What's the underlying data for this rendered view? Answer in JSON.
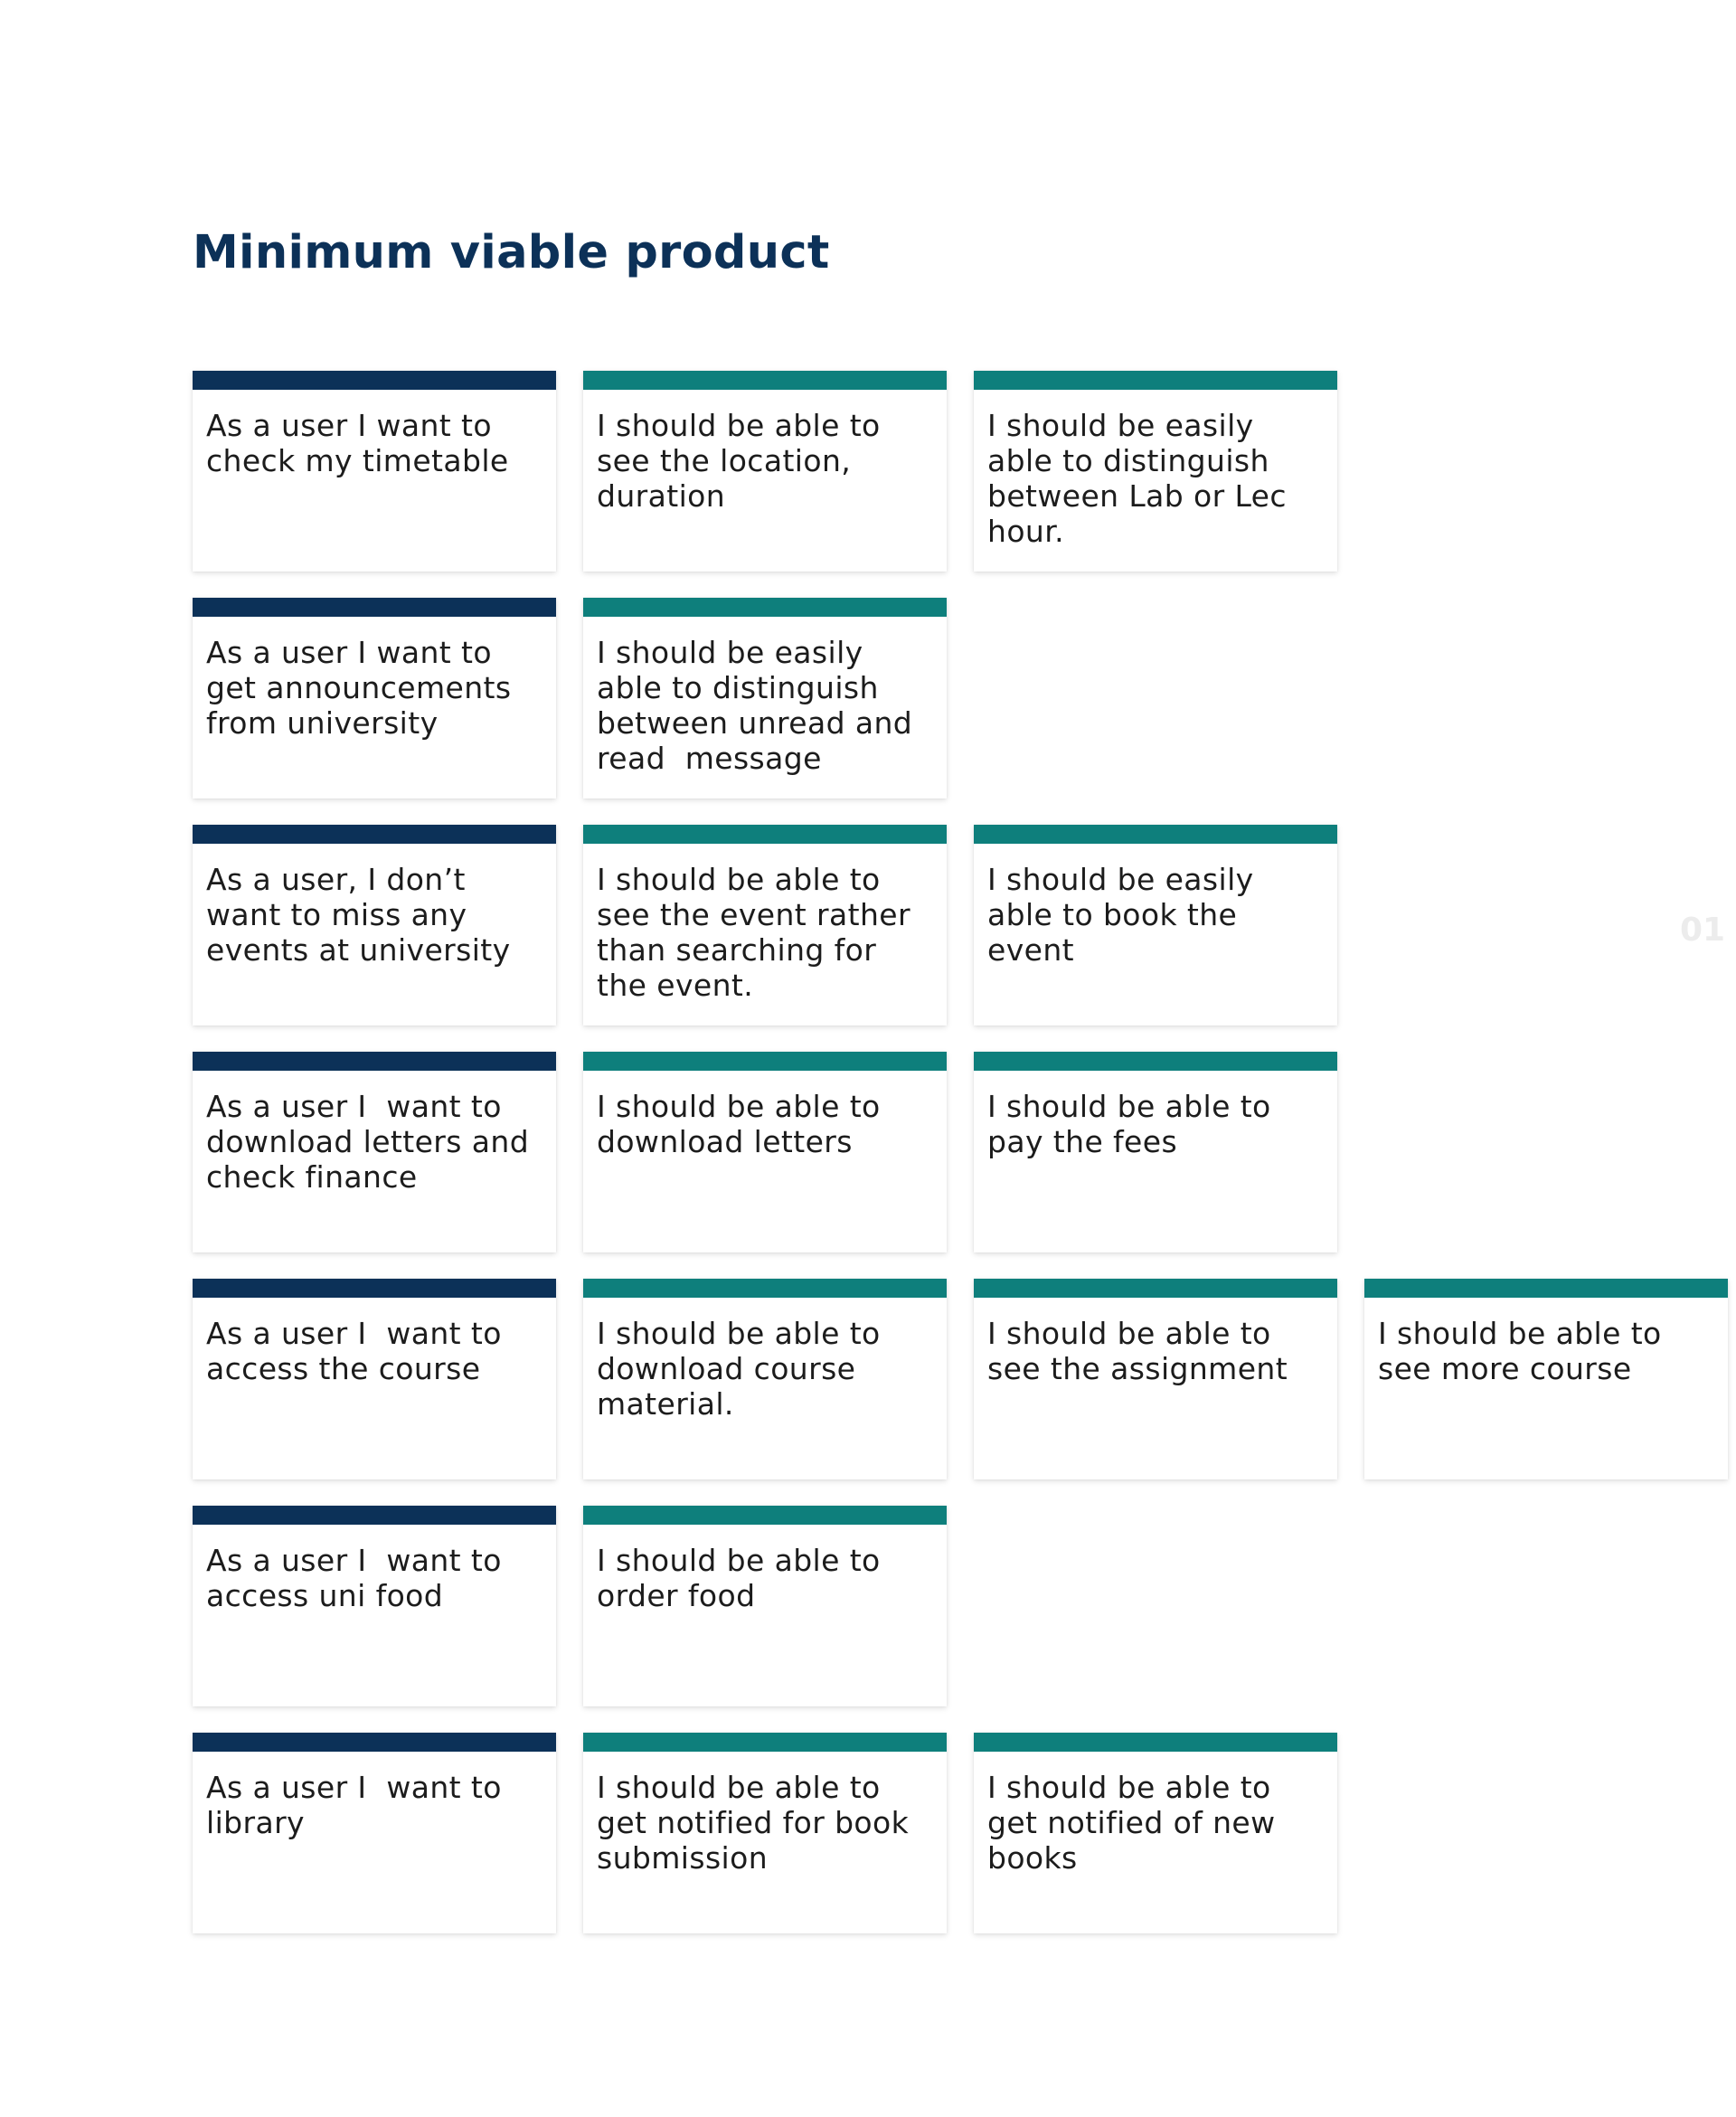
{
  "title": "Minimum viable product",
  "page_number": "01",
  "colors": {
    "epic_bar": "#0c3158",
    "story_bar": "#0e7f7c",
    "title": "#0c3158"
  },
  "rows": [
    {
      "epic": "As a user I want to check my timetable",
      "stories": [
        "I should be able to see the location, duration",
        "I should be easily able to distinguish between Lab or Lec hour."
      ]
    },
    {
      "epic": "As a user I want to get announcements from university",
      "stories": [
        "I should be easily able to distinguish between unread and read  message"
      ]
    },
    {
      "epic": "As a user, I don’t want to miss any events at university",
      "stories": [
        "I should be able to see the event rather than searching for the event.",
        "I should be easily able to book the event"
      ]
    },
    {
      "epic": "As a user I  want to download letters and check finance",
      "stories": [
        "I should be able to download letters",
        "I should be able to pay the fees"
      ]
    },
    {
      "epic": "As a user I  want to access the course",
      "stories": [
        "I should be able to download course material.",
        "I should be able to see the assignment",
        "I should be able to see more course"
      ]
    },
    {
      "epic": "As a user I  want to access uni food",
      "stories": [
        "I should be able to order food"
      ]
    },
    {
      "epic": "As a user I  want to library",
      "stories": [
        "I should be able to get notified for book submission",
        "I should be able to get notified of new books"
      ]
    }
  ]
}
